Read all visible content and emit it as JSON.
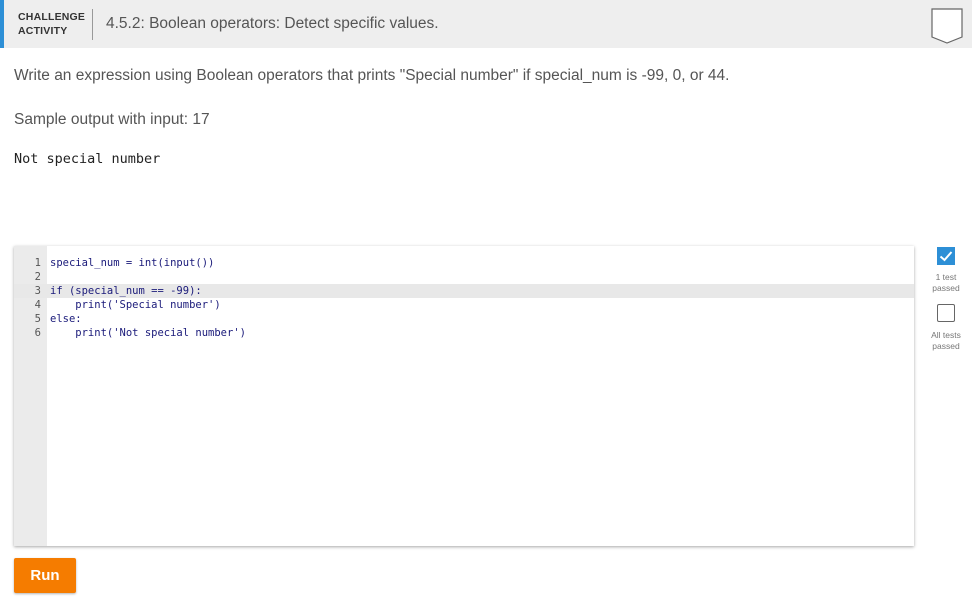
{
  "header": {
    "label_line1": "CHALLENGE",
    "label_line2": "ACTIVITY",
    "title": "4.5.2: Boolean operators: Detect specific values.",
    "bookmark_icon": "bookmark-icon"
  },
  "prompt": "Write an expression using Boolean operators that prints \"Special number\" if special_num is -99, 0, or 44.",
  "sample": {
    "label": "Sample output with input: 17",
    "output": "Not special number"
  },
  "editor": {
    "lines": [
      {
        "num": "1",
        "text": "special_num = int(input())"
      },
      {
        "num": "2",
        "text": ""
      },
      {
        "num": "3",
        "text": "if (special_num == -99):"
      },
      {
        "num": "4",
        "text": "    print('Special number')"
      },
      {
        "num": "5",
        "text": "else:"
      },
      {
        "num": "6",
        "text": "    print('Not special number')"
      }
    ],
    "active_line": 3
  },
  "tests": {
    "one_test_label_line1": "1 test",
    "one_test_label_line2": "passed",
    "one_test_checked": true,
    "all_tests_label_line1": "All tests",
    "all_tests_label_line2": "passed",
    "all_tests_checked": false
  },
  "run_button": "Run",
  "colors": {
    "accent": "#2d8fd6",
    "run_button": "#f57c00",
    "header_bg": "#eeeeee"
  }
}
